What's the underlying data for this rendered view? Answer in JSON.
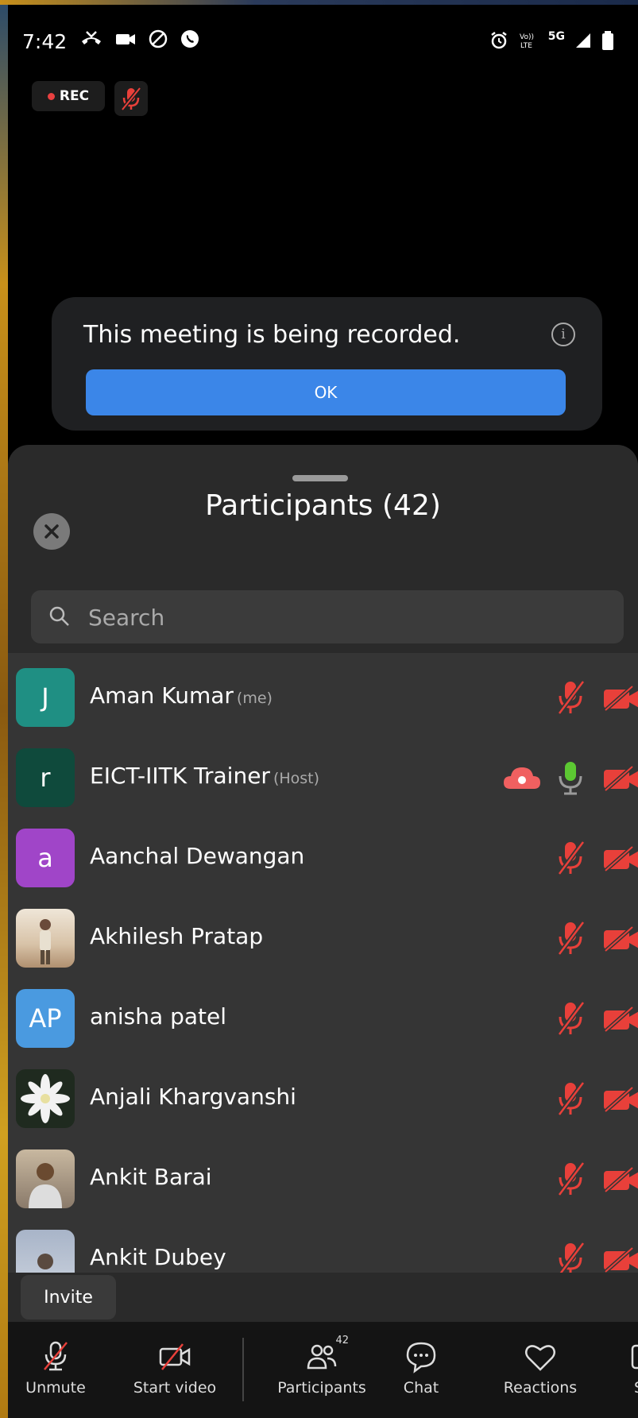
{
  "status_bar": {
    "time": "7:42",
    "network": "5G"
  },
  "recording": {
    "rec_label": "REC"
  },
  "record_notice": {
    "message": "This meeting is being recorded.",
    "ok_label": "OK"
  },
  "participants_panel": {
    "title": "Participants (42)",
    "search_placeholder": "Search",
    "participants": [
      {
        "avatar": "J",
        "avatar_color": "#1f8f83",
        "name": "Aman Kumar",
        "tag": "(me)",
        "mic": "muted",
        "video": "off"
      },
      {
        "avatar": "r",
        "avatar_color": "#0f4a3c",
        "name": "EICT-IITK Trainer",
        "tag": "(Host)",
        "mic": "on",
        "video": "off",
        "recording": true
      },
      {
        "avatar": "a",
        "avatar_color": "#a045c8",
        "name": "Aanchal Dewangan",
        "tag": "",
        "mic": "muted",
        "video": "off"
      },
      {
        "avatar": "photo",
        "avatar_color": "#d8c3a8",
        "name": "Akhilesh Pratap",
        "tag": "",
        "mic": "muted",
        "video": "off"
      },
      {
        "avatar": "AP",
        "avatar_color": "#4a9ae0",
        "name": "anisha patel",
        "tag": "",
        "mic": "muted",
        "video": "off"
      },
      {
        "avatar": "photo",
        "avatar_color": "#2a3a2a",
        "name": "Anjali Khargvanshi",
        "tag": "",
        "mic": "muted",
        "video": "off"
      },
      {
        "avatar": "photo",
        "avatar_color": "#8a7a6a",
        "name": "Ankit Barai",
        "tag": "",
        "mic": "muted",
        "video": "off"
      },
      {
        "avatar": "photo",
        "avatar_color": "#a8b4c8",
        "name": "Ankit Dubey",
        "tag": "",
        "mic": "muted",
        "video": "off"
      }
    ],
    "invite_label": "Invite"
  },
  "toolbar": {
    "unmute": "Unmute",
    "start_video": "Start video",
    "participants": "Participants",
    "participants_count": "42",
    "chat": "Chat",
    "reactions": "Reactions",
    "share": "Sh"
  },
  "colors": {
    "accent": "#3b86e8",
    "muted_red": "#e8403a",
    "mic_green": "#5cc832"
  }
}
